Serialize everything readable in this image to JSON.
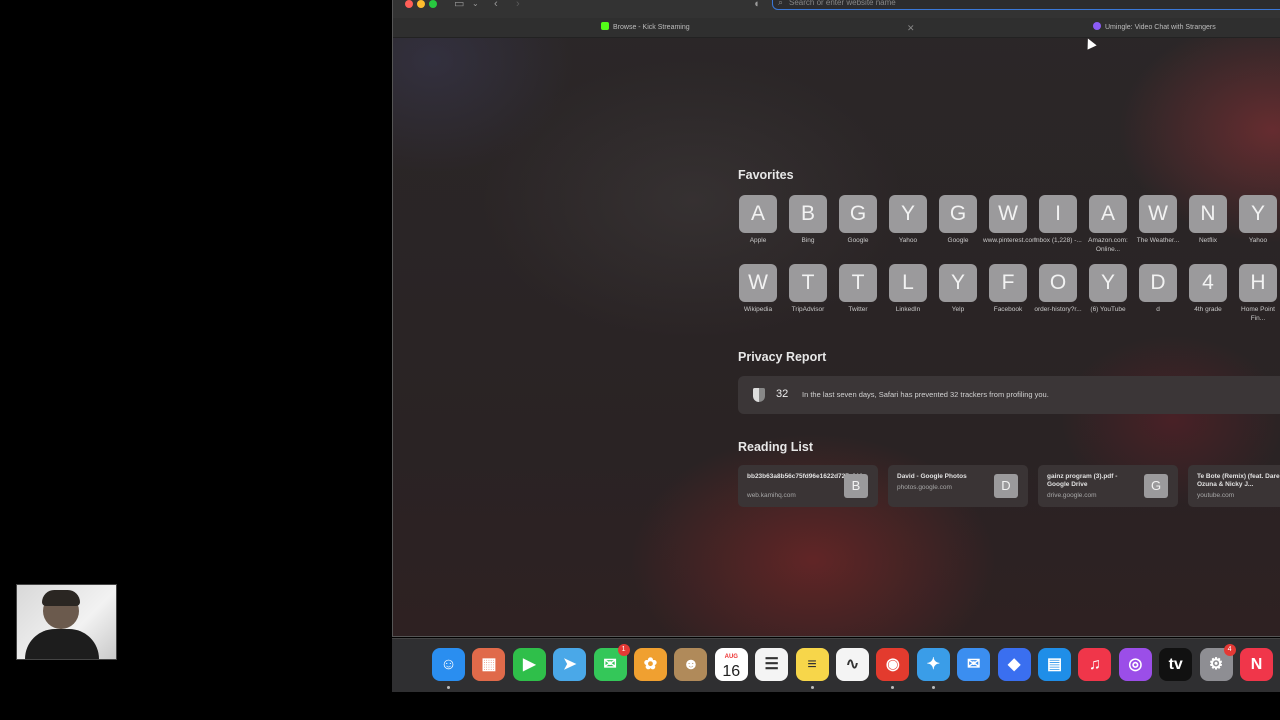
{
  "address_bar": {
    "placeholder": "Search or enter website name"
  },
  "tabs": [
    {
      "label": "Browse - Kick Streaming",
      "favicon_color": "#53fc18"
    },
    {
      "label": "Umingle: Video Chat with Strangers",
      "favicon_color": "#8b5cf6"
    }
  ],
  "favorites": {
    "title": "Favorites",
    "items": [
      {
        "letter": "A",
        "label": "Apple"
      },
      {
        "letter": "B",
        "label": "Bing"
      },
      {
        "letter": "G",
        "label": "Google"
      },
      {
        "letter": "Y",
        "label": "Yahoo"
      },
      {
        "letter": "G",
        "label": "Google"
      },
      {
        "letter": "W",
        "label": "www.pinterest.com"
      },
      {
        "letter": "I",
        "label": "Inbox (1,228) -..."
      },
      {
        "letter": "A",
        "label": "Amazon.com: Online..."
      },
      {
        "letter": "W",
        "label": "The Weather..."
      },
      {
        "letter": "N",
        "label": "Netflix"
      },
      {
        "letter": "Y",
        "label": "Yahoo"
      },
      {
        "letter": "W",
        "label": "Wikipedia"
      },
      {
        "letter": "T",
        "label": "TripAdvisor"
      },
      {
        "letter": "T",
        "label": "Twitter"
      },
      {
        "letter": "L",
        "label": "LinkedIn"
      },
      {
        "letter": "Y",
        "label": "Yelp"
      },
      {
        "letter": "F",
        "label": "Facebook"
      },
      {
        "letter": "O",
        "label": "order-history?r..."
      },
      {
        "letter": "Y",
        "label": "(6) YouTube"
      },
      {
        "letter": "D",
        "label": "d"
      },
      {
        "letter": "4",
        "label": "4th grade"
      },
      {
        "letter": "H",
        "label": "Home Point Fin..."
      }
    ]
  },
  "privacy_report": {
    "title": "Privacy Report",
    "count": "32",
    "text": "In the last seven days, Safari has prevented 32 trackers from profiling you."
  },
  "reading_list": {
    "title": "Reading List",
    "items": [
      {
        "title": "bb23b63a8b56c75fd96e1622d727efd4",
        "url": "web.kamihq.com",
        "letter": "B"
      },
      {
        "title": "David - Google Photos",
        "url": "photos.google.com",
        "letter": "D"
      },
      {
        "title": "gainz program (3).pdf - Google Drive",
        "url": "drive.google.com",
        "letter": "G"
      },
      {
        "title": "Te Bote (Remix) (feat. Darell, Ozuna & Nicky J...",
        "url": "youtube.com",
        "letter": ""
      }
    ]
  },
  "dock": {
    "items": [
      {
        "name": "finder",
        "glyph": "☺",
        "color": "#2a8ef0",
        "running": true
      },
      {
        "name": "launchpad",
        "glyph": "▦",
        "color": "#e06a4a",
        "running": false
      },
      {
        "name": "facetime",
        "glyph": "▶",
        "color": "#2fbf4a",
        "running": false
      },
      {
        "name": "maps",
        "glyph": "➤",
        "color": "#4aa8e8",
        "running": false
      },
      {
        "name": "messages",
        "glyph": "✉",
        "color": "#34c759",
        "running": false,
        "badge": "1"
      },
      {
        "name": "photos",
        "glyph": "✿",
        "color": "#f0a030",
        "running": false
      },
      {
        "name": "contacts",
        "glyph": "☻",
        "color": "#b08a5a",
        "running": false
      },
      {
        "name": "calendar",
        "glyph": "16",
        "color": "#ffffff",
        "running": false,
        "month": "AUG"
      },
      {
        "name": "reminders",
        "glyph": "☰",
        "color": "#f4f4f4",
        "running": false
      },
      {
        "name": "notes",
        "glyph": "≡",
        "color": "#f7d64a",
        "running": true
      },
      {
        "name": "freeform",
        "glyph": "∿",
        "color": "#f4f4f4",
        "running": false
      },
      {
        "name": "chrome",
        "glyph": "◉",
        "color": "#e33b2e",
        "running": true
      },
      {
        "name": "safari",
        "glyph": "✦",
        "color": "#3a9de8",
        "running": true
      },
      {
        "name": "mail",
        "glyph": "✉",
        "color": "#3b8ef0",
        "running": false
      },
      {
        "name": "roblox",
        "glyph": "◆",
        "color": "#3a6ff0",
        "running": false
      },
      {
        "name": "app-store-grid",
        "glyph": "▤",
        "color": "#1f8ee8",
        "running": false
      },
      {
        "name": "music",
        "glyph": "♫",
        "color": "#f0364a",
        "running": false
      },
      {
        "name": "podcasts",
        "glyph": "◎",
        "color": "#9b4ee8",
        "running": false
      },
      {
        "name": "apple-tv",
        "glyph": "tv",
        "color": "#111111",
        "running": false
      },
      {
        "name": "system-settings",
        "glyph": "⚙",
        "color": "#8e8e93",
        "running": false,
        "badge": "4"
      },
      {
        "name": "news",
        "glyph": "N",
        "color": "#f0364a",
        "running": false
      }
    ]
  }
}
